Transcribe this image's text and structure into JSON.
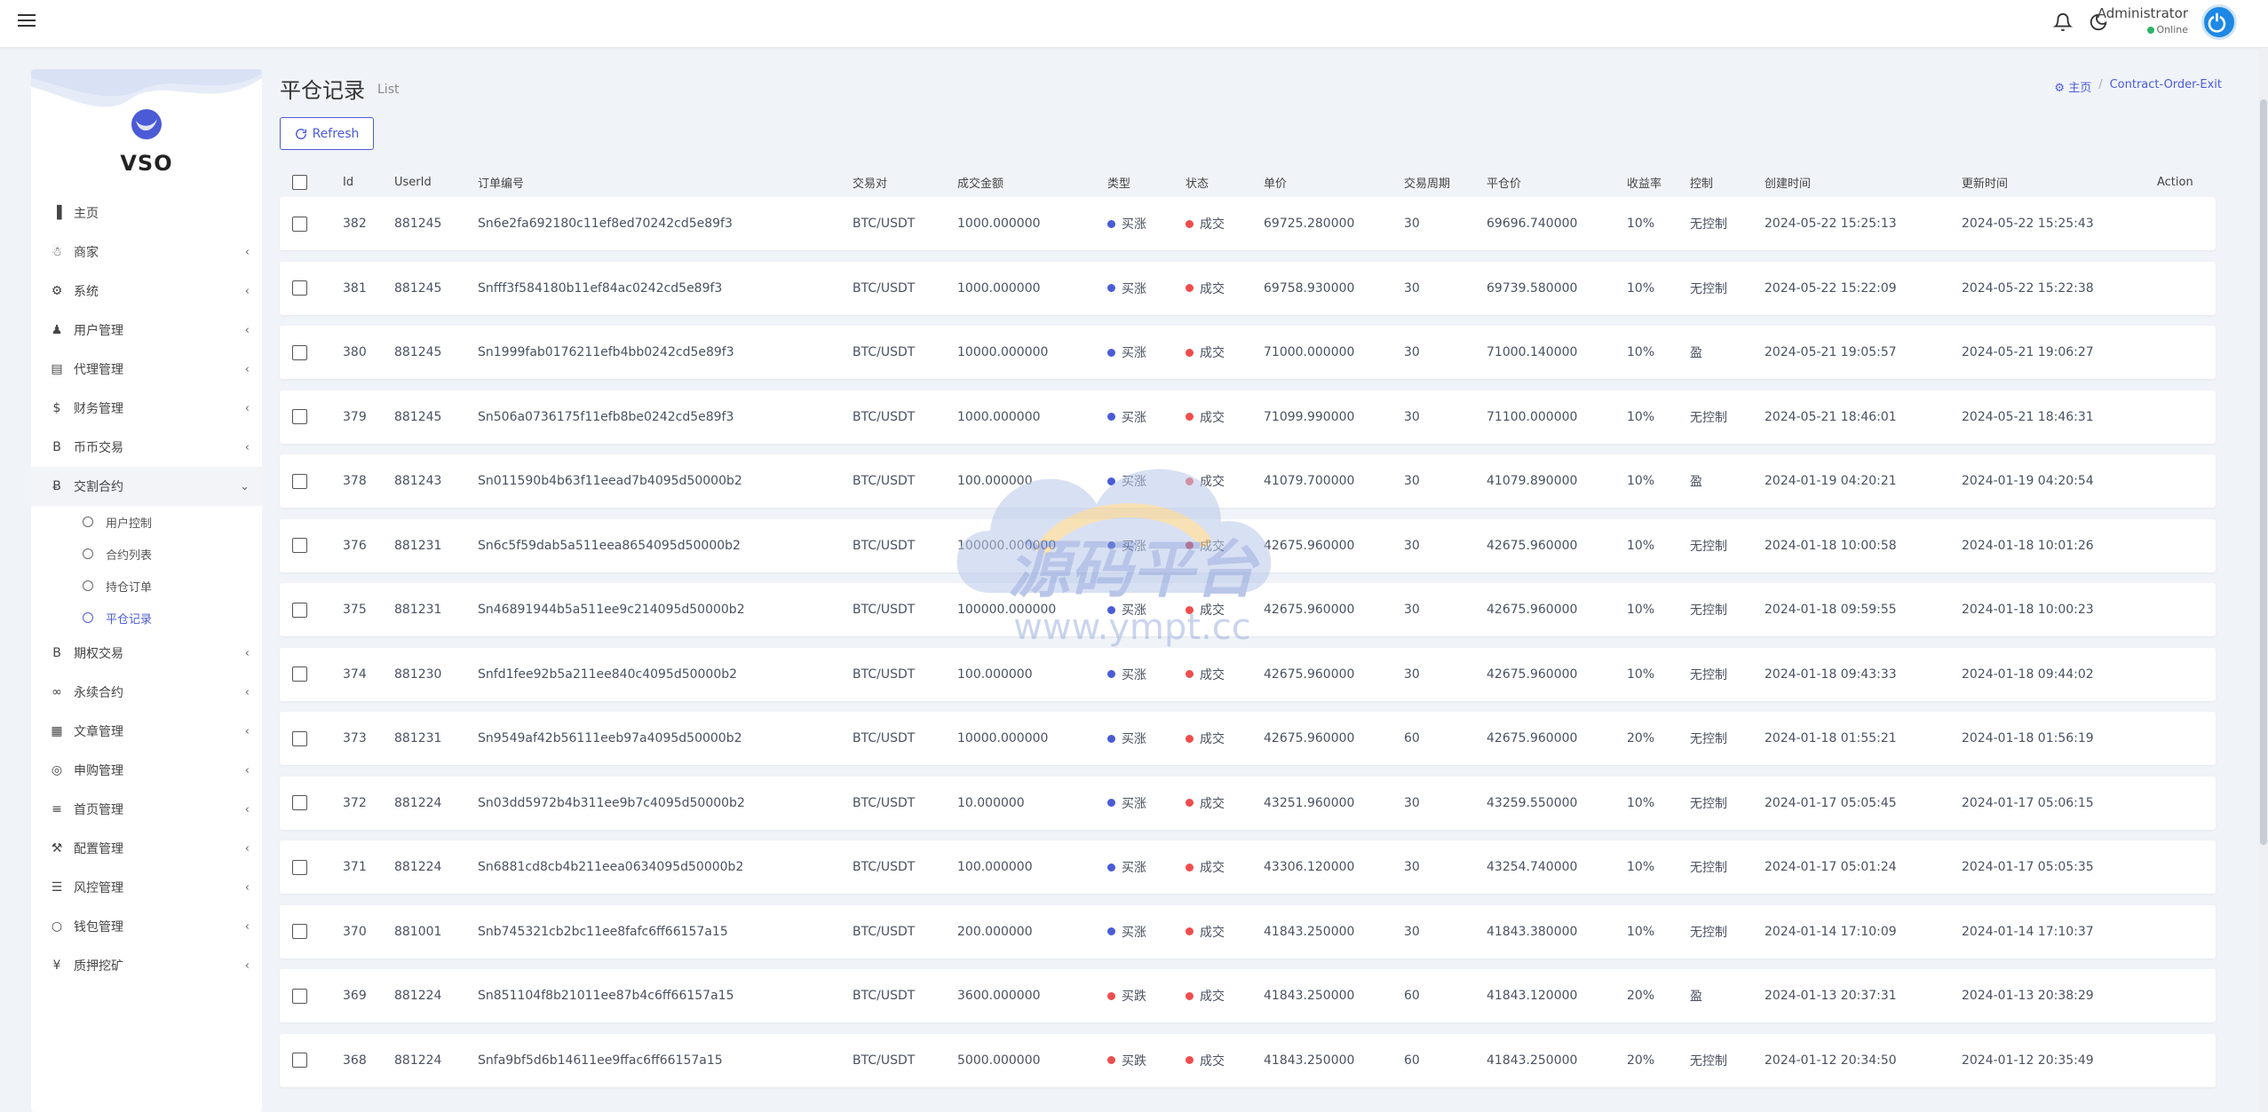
{
  "topbar": {
    "user_name": "Administrator",
    "user_status": "Online"
  },
  "brand": {
    "name": "VSO"
  },
  "sidebar": {
    "items": [
      {
        "label": "主页",
        "icon": "bar-chart-icon",
        "has_children": false
      },
      {
        "label": "商家",
        "icon": "users-icon",
        "has_children": true
      },
      {
        "label": "系统",
        "icon": "gear-icon",
        "has_children": true
      },
      {
        "label": "用户管理",
        "icon": "user-icon",
        "has_children": true
      },
      {
        "label": "代理管理",
        "icon": "id-card-icon",
        "has_children": true
      },
      {
        "label": "财务管理",
        "icon": "dollar-icon",
        "has_children": true
      },
      {
        "label": "币币交易",
        "icon": "bitcoin-icon",
        "has_children": true
      },
      {
        "label": "交割合约",
        "icon": "bitcoin-circle-icon",
        "has_children": true,
        "open": true,
        "children": [
          {
            "label": "用户控制"
          },
          {
            "label": "合约列表"
          },
          {
            "label": "持仓订单"
          },
          {
            "label": "平仓记录",
            "active": true
          }
        ]
      },
      {
        "label": "期权交易",
        "icon": "bitcoin-icon",
        "has_children": true
      },
      {
        "label": "永续合约",
        "icon": "link-icon",
        "has_children": true
      },
      {
        "label": "文章管理",
        "icon": "newspaper-icon",
        "has_children": true
      },
      {
        "label": "申购管理",
        "icon": "lifebuoy-icon",
        "has_children": true
      },
      {
        "label": "首页管理",
        "icon": "list-icon",
        "has_children": true
      },
      {
        "label": "配置管理",
        "icon": "wrench-icon",
        "has_children": true
      },
      {
        "label": "风控管理",
        "icon": "indent-icon",
        "has_children": true
      },
      {
        "label": "钱包管理",
        "icon": "circle-icon",
        "has_children": true
      },
      {
        "label": "质押挖矿",
        "icon": "yen-icon",
        "has_children": true
      }
    ]
  },
  "page": {
    "title": "平仓记录",
    "subtitle": "List",
    "breadcrumb": {
      "home": "主页",
      "current": "Contract-Order-Exit"
    },
    "refresh_label": "Refresh"
  },
  "table": {
    "columns": [
      "Id",
      "UserId",
      "订单编号",
      "交易对",
      "成交金额",
      "类型",
      "状态",
      "单价",
      "交易周期",
      "平仓价",
      "收益率",
      "控制",
      "创建时间",
      "更新时间",
      "Action"
    ],
    "rows": [
      {
        "id": "382",
        "userid": "881245",
        "order": "Sn6e2fa692180c11ef8ed70242cd5e89f3",
        "pair": "BTC/USDT",
        "amount": "1000.000000",
        "type": "买涨",
        "type_color": "#4b5bd6",
        "status": "成交",
        "price": "69725.280000",
        "period": "30",
        "close": "69696.740000",
        "rate": "10%",
        "control": "无控制",
        "created": "2024-05-22 15:25:13",
        "updated": "2024-05-22 15:25:43"
      },
      {
        "id": "381",
        "userid": "881245",
        "order": "Snfff3f584180b11ef84ac0242cd5e89f3",
        "pair": "BTC/USDT",
        "amount": "1000.000000",
        "type": "买涨",
        "type_color": "#4b5bd6",
        "status": "成交",
        "price": "69758.930000",
        "period": "30",
        "close": "69739.580000",
        "rate": "10%",
        "control": "无控制",
        "created": "2024-05-22 15:22:09",
        "updated": "2024-05-22 15:22:38"
      },
      {
        "id": "380",
        "userid": "881245",
        "order": "Sn1999fab0176211efb4bb0242cd5e89f3",
        "pair": "BTC/USDT",
        "amount": "10000.000000",
        "type": "买涨",
        "type_color": "#4b5bd6",
        "status": "成交",
        "price": "71000.000000",
        "period": "30",
        "close": "71000.140000",
        "rate": "10%",
        "control": "盈",
        "created": "2024-05-21 19:05:57",
        "updated": "2024-05-21 19:06:27"
      },
      {
        "id": "379",
        "userid": "881245",
        "order": "Sn506a0736175f11efb8be0242cd5e89f3",
        "pair": "BTC/USDT",
        "amount": "1000.000000",
        "type": "买涨",
        "type_color": "#4b5bd6",
        "status": "成交",
        "price": "71099.990000",
        "period": "30",
        "close": "71100.000000",
        "rate": "10%",
        "control": "无控制",
        "created": "2024-05-21 18:46:01",
        "updated": "2024-05-21 18:46:31"
      },
      {
        "id": "378",
        "userid": "881243",
        "order": "Sn011590b4b63f11eead7b4095d50000b2",
        "pair": "BTC/USDT",
        "amount": "100.000000",
        "type": "买涨",
        "type_color": "#4b5bd6",
        "status": "成交",
        "price": "41079.700000",
        "period": "30",
        "close": "41079.890000",
        "rate": "10%",
        "control": "盈",
        "created": "2024-01-19 04:20:21",
        "updated": "2024-01-19 04:20:54"
      },
      {
        "id": "376",
        "userid": "881231",
        "order": "Sn6c5f59dab5a511eea8654095d50000b2",
        "pair": "BTC/USDT",
        "amount": "100000.000000",
        "type": "买涨",
        "type_color": "#4b5bd6",
        "status": "成交",
        "price": "42675.960000",
        "period": "30",
        "close": "42675.960000",
        "rate": "10%",
        "control": "无控制",
        "created": "2024-01-18 10:00:58",
        "updated": "2024-01-18 10:01:26"
      },
      {
        "id": "375",
        "userid": "881231",
        "order": "Sn46891944b5a511ee9c214095d50000b2",
        "pair": "BTC/USDT",
        "amount": "100000.000000",
        "type": "买涨",
        "type_color": "#4b5bd6",
        "status": "成交",
        "price": "42675.960000",
        "period": "30",
        "close": "42675.960000",
        "rate": "10%",
        "control": "无控制",
        "created": "2024-01-18 09:59:55",
        "updated": "2024-01-18 10:00:23"
      },
      {
        "id": "374",
        "userid": "881230",
        "order": "Snfd1fee92b5a211ee840c4095d50000b2",
        "pair": "BTC/USDT",
        "amount": "100.000000",
        "type": "买涨",
        "type_color": "#4b5bd6",
        "status": "成交",
        "price": "42675.960000",
        "period": "30",
        "close": "42675.960000",
        "rate": "10%",
        "control": "无控制",
        "created": "2024-01-18 09:43:33",
        "updated": "2024-01-18 09:44:02"
      },
      {
        "id": "373",
        "userid": "881231",
        "order": "Sn9549af42b56111eeb97a4095d50000b2",
        "pair": "BTC/USDT",
        "amount": "10000.000000",
        "type": "买涨",
        "type_color": "#4b5bd6",
        "status": "成交",
        "price": "42675.960000",
        "period": "60",
        "close": "42675.960000",
        "rate": "20%",
        "control": "无控制",
        "created": "2024-01-18 01:55:21",
        "updated": "2024-01-18 01:56:19"
      },
      {
        "id": "372",
        "userid": "881224",
        "order": "Sn03dd5972b4b311ee9b7c4095d50000b2",
        "pair": "BTC/USDT",
        "amount": "10.000000",
        "type": "买涨",
        "type_color": "#4b5bd6",
        "status": "成交",
        "price": "43251.960000",
        "period": "30",
        "close": "43259.550000",
        "rate": "10%",
        "control": "无控制",
        "created": "2024-01-17 05:05:45",
        "updated": "2024-01-17 05:06:15"
      },
      {
        "id": "371",
        "userid": "881224",
        "order": "Sn6881cd8cb4b211eea0634095d50000b2",
        "pair": "BTC/USDT",
        "amount": "100.000000",
        "type": "买涨",
        "type_color": "#4b5bd6",
        "status": "成交",
        "price": "43306.120000",
        "period": "30",
        "close": "43254.740000",
        "rate": "10%",
        "control": "无控制",
        "created": "2024-01-17 05:01:24",
        "updated": "2024-01-17 05:05:35"
      },
      {
        "id": "370",
        "userid": "881001",
        "order": "Snb745321cb2bc11ee8fafc6ff66157a15",
        "pair": "BTC/USDT",
        "amount": "200.000000",
        "type": "买涨",
        "type_color": "#4b5bd6",
        "status": "成交",
        "price": "41843.250000",
        "period": "30",
        "close": "41843.380000",
        "rate": "10%",
        "control": "无控制",
        "created": "2024-01-14 17:10:09",
        "updated": "2024-01-14 17:10:37"
      },
      {
        "id": "369",
        "userid": "881224",
        "order": "Sn851104f8b21011ee87b4c6ff66157a15",
        "pair": "BTC/USDT",
        "amount": "3600.000000",
        "type": "买跌",
        "type_color": "#ef4d4d",
        "status": "成交",
        "price": "41843.250000",
        "period": "60",
        "close": "41843.120000",
        "rate": "20%",
        "control": "盈",
        "created": "2024-01-13 20:37:31",
        "updated": "2024-01-13 20:38:29"
      },
      {
        "id": "368",
        "userid": "881224",
        "order": "Snfa9bf5d6b14611ee9ffac6ff66157a15",
        "pair": "BTC/USDT",
        "amount": "5000.000000",
        "type": "买跌",
        "type_color": "#ef4d4d",
        "status": "成交",
        "price": "41843.250000",
        "period": "60",
        "close": "41843.250000",
        "rate": "20%",
        "control": "无控制",
        "created": "2024-01-12 20:34:50",
        "updated": "2024-01-12 20:35:49"
      }
    ]
  },
  "watermark": {
    "text_cn": "源码平台",
    "text_url": "www.ympt.cc"
  },
  "colors": {
    "accent": "#4b5bd6",
    "status_red": "#ef4d4d",
    "online_green": "#2fb36a",
    "power_blue": "#1e88e5"
  }
}
